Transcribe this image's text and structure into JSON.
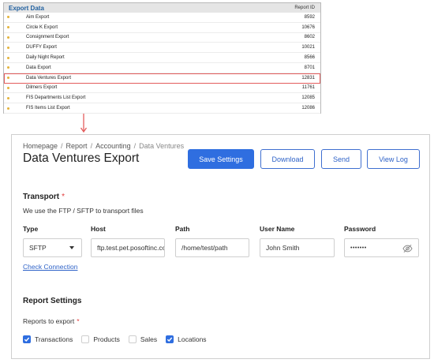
{
  "export_list": {
    "title": "Export Data",
    "column_header": "Report ID",
    "rows": [
      {
        "name": "Aim Export",
        "id": "8592",
        "selected": false
      },
      {
        "name": "Circle K Export",
        "id": "10676",
        "selected": false
      },
      {
        "name": "Consignment Export",
        "id": "8602",
        "selected": false
      },
      {
        "name": "DUFFY Export",
        "id": "10021",
        "selected": false
      },
      {
        "name": "Daily Night Report",
        "id": "8566",
        "selected": false
      },
      {
        "name": "Data Export",
        "id": "8701",
        "selected": false
      },
      {
        "name": "Data Ventures Export",
        "id": "12831",
        "selected": true
      },
      {
        "name": "Dilmers Export",
        "id": "11761",
        "selected": false
      },
      {
        "name": "FIS Departments List Export",
        "id": "12085",
        "selected": false
      },
      {
        "name": "FIS Items List Export",
        "id": "12086",
        "selected": false
      }
    ]
  },
  "breadcrumb": {
    "items": [
      "Homepage",
      "Report",
      "Accounting"
    ],
    "current": "Data Ventures",
    "separator": "/"
  },
  "page_title": "Data Ventures Export",
  "buttons": {
    "save": "Save Settings",
    "download": "Download",
    "send": "Send",
    "view_log": "View Log"
  },
  "transport": {
    "title": "Transport",
    "required_mark": "*",
    "hint": "We use the FTP / SFTP to transport files",
    "type_label": "Type",
    "type_value": "SFTP",
    "host_label": "Host",
    "host_value": "ftp.test.pet.posoftinc.com",
    "path_label": "Path",
    "path_value": "/home/test/path",
    "user_label": "User Name",
    "user_value": "John Smith",
    "password_label": "Password",
    "password_value": "•••••••",
    "check_connection": "Check Connection"
  },
  "report_settings": {
    "title": "Report Settings",
    "reports_label": "Reports to export",
    "required_mark": "*",
    "options": [
      {
        "label": "Transactions",
        "checked": true
      },
      {
        "label": "Products",
        "checked": false
      },
      {
        "label": "Sales",
        "checked": false
      },
      {
        "label": "Locations",
        "checked": true
      }
    ]
  },
  "colors": {
    "accent": "#2f6ee0",
    "highlight_border": "#e35d5d",
    "required": "#e23b3b",
    "bullet": "#e4b23a"
  }
}
